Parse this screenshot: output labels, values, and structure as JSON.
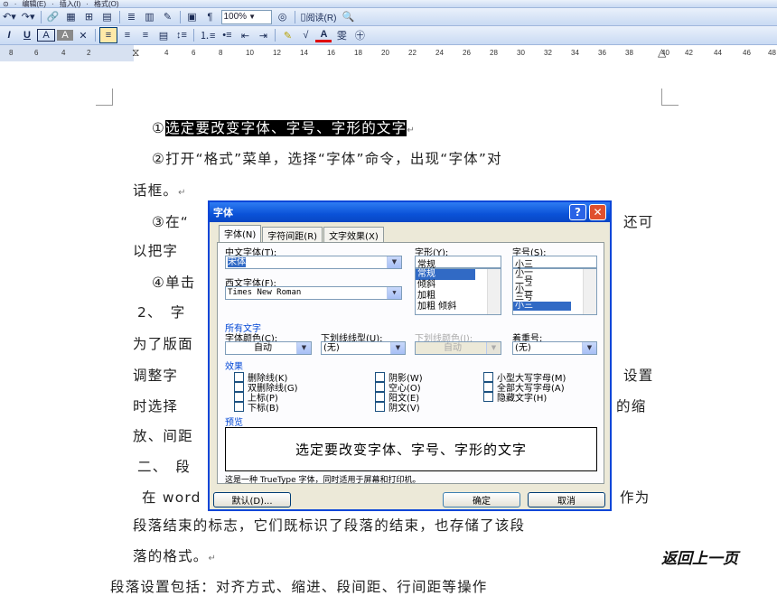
{
  "toolbar_top": {
    "items": [
      "⊙",
      "·",
      "编辑(E)",
      "·",
      "插入(I)",
      "·",
      "格式(O)"
    ]
  },
  "toolbar1": {
    "zoom": "100%",
    "read_label": "阅读(R)",
    "icons": [
      "undo-icon",
      "redo-icon",
      "hyperlink-icon",
      "tables-borders-icon",
      "insert-table-icon",
      "insert-excel-icon",
      "columns-icon",
      "drawing-icon",
      "document-map-icon",
      "show-hide-icon",
      "help-icon",
      "read-icon"
    ]
  },
  "toolbar2": {
    "buttons": [
      "I",
      "U",
      "A",
      "A",
      "✕"
    ]
  },
  "ruler": {
    "ticks": [
      "8",
      "6",
      "4",
      "2",
      "4",
      "6",
      "8",
      "10",
      "12",
      "14",
      "16",
      "18",
      "20",
      "22",
      "24",
      "26",
      "28",
      "30",
      "32",
      "34",
      "36",
      "38",
      "40",
      "42",
      "44",
      "46",
      "48"
    ]
  },
  "document": {
    "line1_prefix": "①",
    "line1_selected": "选定要改变字体、字号、字形的文字",
    "line2": "②打开“格式”菜单，选择“字体”命令，出现“字体”对",
    "line3": "话框。",
    "line4a": "③在“",
    "line4b": "还可",
    "line5": "以把字",
    "line6": "④单击",
    "line7": "2、　字",
    "line8": "为了版面",
    "line9a": "调整字",
    "line9b": "设置",
    "line10a": "时选择",
    "line10b": "的缩",
    "line11": "放、间距",
    "line12": "二、　段",
    "line13a": "在 word",
    "line13b": "作为",
    "line14": "段落结束的标志，它们既标识了段落的结束，也存储了该段",
    "line15": "落的格式。",
    "line16": "段落设置包括：对齐方式、缩进、段间距、行间距等操作",
    "return_mark": "↵",
    "back_link": "返回上一页"
  },
  "dialog": {
    "title": "字体",
    "help": "?",
    "close": "✕",
    "tabs": [
      "字体(N)",
      "字符间距(R)",
      "文字效果(X)"
    ],
    "cn_font_label": "中文字体(T):",
    "cn_font_value": "宋体",
    "style_label": "字形(Y):",
    "style_value": "常规",
    "style_options": [
      "常规",
      "倾斜",
      "加粗",
      "加粗 倾斜"
    ],
    "size_label": "字号(S):",
    "size_value": "小三",
    "size_options": [
      "小一",
      "二号",
      "小二",
      "三号",
      "小三"
    ],
    "west_font_label": "西文字体(F):",
    "west_font_value": "Times New Roman",
    "all_text_label": "所有文字",
    "font_color_label": "字体颜色(C):",
    "font_color_value": "自动",
    "underline_label": "下划线线型(U):",
    "underline_value": "(无)",
    "underline_color_label": "下划线颜色(I):",
    "underline_color_value": "自动",
    "emphasis_label": "着重号;",
    "emphasis_value": "(无)",
    "effects_label": "效果",
    "effects_col1": [
      "删除线(K)",
      "双删除线(G)",
      "上标(P)",
      "下标(B)"
    ],
    "effects_col2": [
      "阴影(W)",
      "空心(O)",
      "阳文(E)",
      "阴文(V)"
    ],
    "effects_col3": [
      "小型大写字母(M)",
      "全部大写字母(A)",
      "隐藏文字(H)"
    ],
    "preview_label": "预览",
    "preview_text": "选定要改变字体、字号、字形的文字",
    "note": "这是一种 TrueType 字体，同时适用于屏幕和打印机。",
    "default_button": "默认(D)...",
    "ok_button": "确定",
    "cancel_button": "取消"
  }
}
